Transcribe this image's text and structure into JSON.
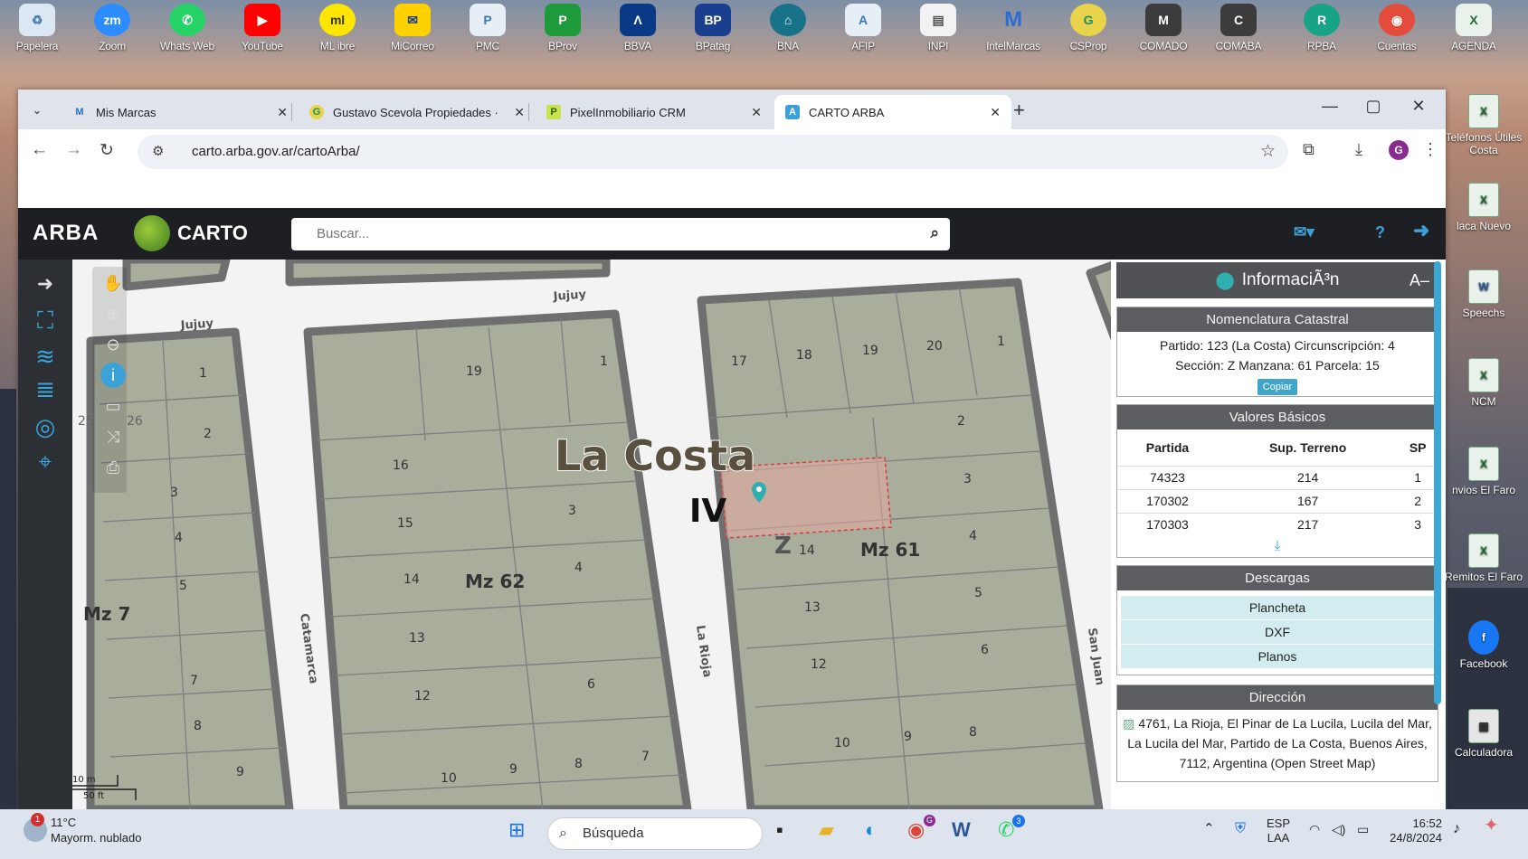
{
  "desktop": {
    "icons": [
      "Papelera",
      "Zoom",
      "Whats Web",
      "YouTube",
      "ML ibre",
      "MiCorreo",
      "PMC",
      "BProv",
      "BBVA",
      "BPatag",
      "BNA",
      "AFIP",
      "INPI",
      "IntelMarcas",
      "CSProp",
      "COMADO",
      "COMABA",
      "RPBA",
      "Cuentas",
      "AGENDA"
    ],
    "right_icons": [
      "Teléfonos Útiles Costa",
      "laca Nuevo",
      "Speechs",
      "NCM",
      "nvios El Faro",
      "Remitos El Faro",
      "Facebook",
      "Calculadora"
    ]
  },
  "browser": {
    "tabs": [
      {
        "label": "Mis Marcas",
        "favicon": "M"
      },
      {
        "label": "Gustavo Scevola Propiedades ·",
        "favicon": "G"
      },
      {
        "label": "PixelInmobiliario CRM",
        "favicon": "P"
      },
      {
        "label": "CARTO ARBA",
        "favicon": "A"
      }
    ],
    "url": "carto.arba.gov.ar/cartoArba/",
    "profile_initial": "G"
  },
  "app": {
    "brand": "ARBA",
    "carto": "CARTO",
    "search_placeholder": "Buscar..."
  },
  "map": {
    "place": "La Costa",
    "circ": "IV",
    "sector": "Z",
    "blocks": [
      "Mz 62",
      "Mz 61",
      "Mz 7"
    ],
    "streets": [
      "Jujuy",
      "Jujuy",
      "Catamarca",
      "La Rioja",
      "San Juan"
    ],
    "scale": [
      "10 m",
      "50 ft"
    ],
    "mz7_lots": [
      "1",
      "2",
      "3",
      "4",
      "5",
      "7",
      "8",
      "9"
    ],
    "mz62_lots": [
      "19",
      "1",
      "16",
      "15",
      "14",
      "13",
      "12",
      "3",
      "4",
      "6",
      "10",
      "9",
      "8",
      "7"
    ],
    "mz61_lots": [
      "17",
      "18",
      "19",
      "20",
      "1",
      "2",
      "3",
      "4",
      "5",
      "6",
      "8",
      "9",
      "10",
      "12",
      "13",
      "14"
    ],
    "stray": [
      "25",
      "26"
    ]
  },
  "panel": {
    "title": "InformaciÃ³n",
    "nomenclatura": {
      "header": "Nomenclatura Catastral",
      "line1": "Partido: 123 (La Costa) Circunscripción: 4",
      "line2": "Sección: Z Manzana: 61 Parcela: 15",
      "copy": "Copiar"
    },
    "valores": {
      "header": "Valores Básicos",
      "cols": [
        "Partida",
        "Sup. Terreno",
        "SP"
      ],
      "rows": [
        [
          "74323",
          "214",
          "1"
        ],
        [
          "170302",
          "167",
          "2"
        ],
        [
          "170303",
          "217",
          "3"
        ]
      ]
    },
    "descargas": {
      "header": "Descargas",
      "items": [
        "Plancheta",
        "DXF",
        "Planos"
      ]
    },
    "direccion": {
      "header": "Dirección",
      "text": "4761, La Rioja, El Pinar de La Lucila, Lucila del Mar, La Lucila del Mar, Partido de La Costa, Buenos Aires, 7112, Argentina (Open Street Map)"
    }
  },
  "taskbar": {
    "temp": "11°C",
    "weather": "Mayorm. nublado",
    "badge": "1",
    "search": "Búsqueda",
    "lang1": "ESP",
    "lang2": "LAA",
    "time": "16:52",
    "date": "24/8/2024",
    "wa_badge": "3",
    "chrome_badge": "G"
  }
}
